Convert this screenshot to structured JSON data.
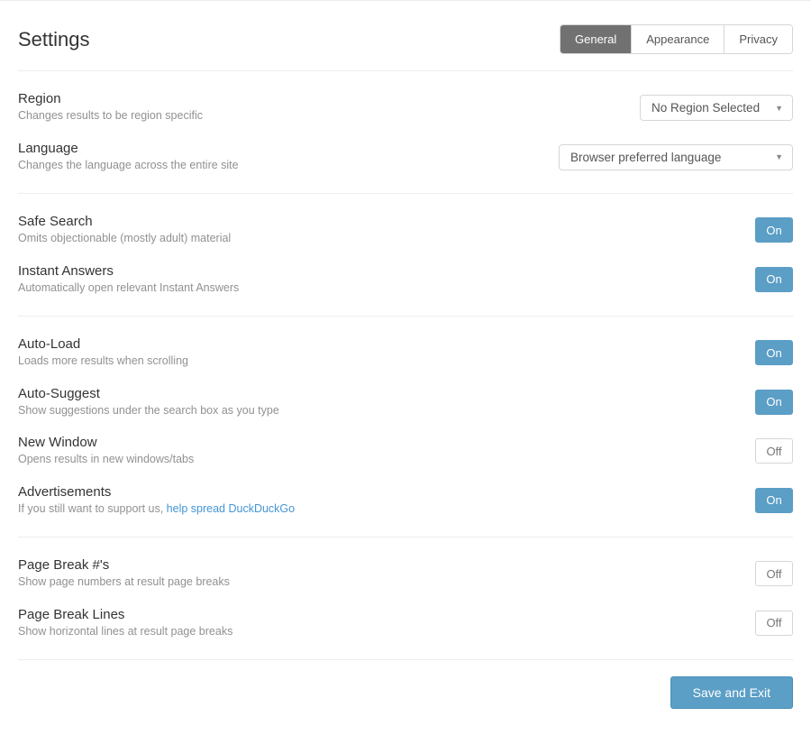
{
  "page": {
    "title": "Settings"
  },
  "tabs": {
    "general": "General",
    "appearance": "Appearance",
    "privacy": "Privacy"
  },
  "toggle_labels": {
    "on": "On",
    "off": "Off"
  },
  "region": {
    "title": "Region",
    "desc": "Changes results to be region specific",
    "value": "No Region Selected"
  },
  "language": {
    "title": "Language",
    "desc": "Changes the language across the entire site",
    "value": "Browser preferred language"
  },
  "safe_search": {
    "title": "Safe Search",
    "desc": "Omits objectionable (mostly adult) material"
  },
  "instant_answers": {
    "title": "Instant Answers",
    "desc": "Automatically open relevant Instant Answers"
  },
  "auto_load": {
    "title": "Auto-Load",
    "desc": "Loads more results when scrolling"
  },
  "auto_suggest": {
    "title": "Auto-Suggest",
    "desc": "Show suggestions under the search box as you type"
  },
  "new_window": {
    "title": "New Window",
    "desc": "Opens results in new windows/tabs"
  },
  "ads": {
    "title": "Advertisements",
    "desc_prefix": "If you still want to support us, ",
    "link_text": "help spread DuckDuckGo"
  },
  "page_break_nums": {
    "title": "Page Break #'s",
    "desc": "Show page numbers at result page breaks"
  },
  "page_break_lines": {
    "title": "Page Break Lines",
    "desc": "Show horizontal lines at result page breaks"
  },
  "footer": {
    "save": "Save and Exit"
  }
}
